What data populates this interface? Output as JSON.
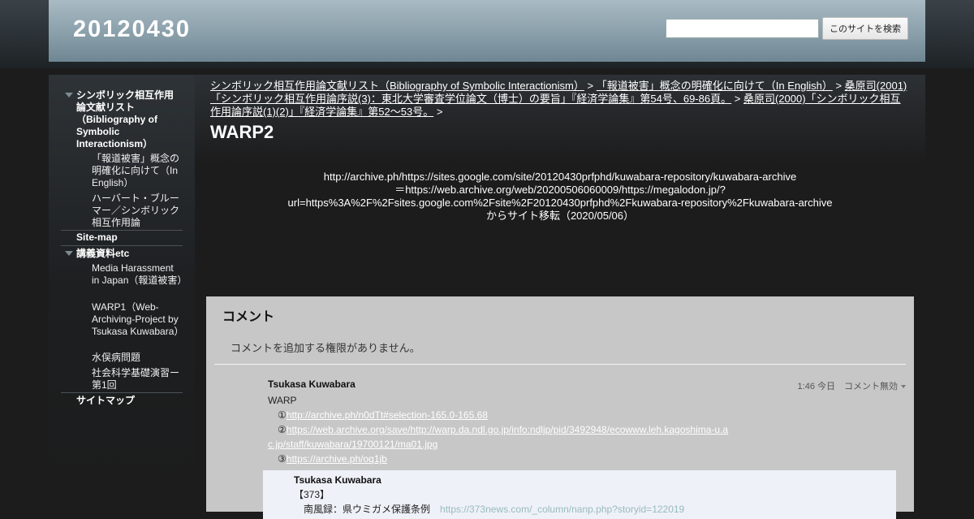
{
  "header": {
    "site_title": "20120430",
    "search_placeholder": "",
    "search_button": "このサイトを検索"
  },
  "sidebar": {
    "items": [
      {
        "label": "シンボリック相互作用論文献リスト（Bibliography of Symbolic Interactionism）"
      },
      {
        "label": "「報道被害」概念の明確化に向けて（In English）"
      },
      {
        "label": "ハーバート・ブルーマー／シンボリック相互作用論"
      },
      {
        "label": "Site-map"
      },
      {
        "label": "講義資料etc"
      },
      {
        "label": "Media Harassment in Japan（報道被害）"
      },
      {
        "label": "WARP1（Web-Archiving-Project by Tsukasa Kuwabara）"
      },
      {
        "label": "水俣病問題"
      },
      {
        "label": "社会科学基礎演習ー第1回"
      },
      {
        "label": "サイトマップ"
      }
    ]
  },
  "breadcrumb": {
    "items": [
      "シンボリック相互作用論文献リスト（Bibliography of Symbolic Interactionism）",
      "「報道被害」概念の明確化に向けて（In English）",
      "桑原司(2001)「シンボリック相互作用論序説(3)：東北大学審査学位論文（博士）の要旨」『経済学論集』第54号、69-86頁。",
      "桑原司(2000)「シンボリック相互作用論序説(1)(2)」『経済学論集』第52～53号。"
    ],
    "separator": ">"
  },
  "page": {
    "title": "WARP2",
    "lines": [
      "http://archive.ph/https://sites.google.com/site/20120430prfphd/kuwabara-repository/kuwabara-archive",
      "＝https://web.archive.org/web/20200506060009/https://megalodon.jp/?",
      "url=https%3A%2F%2Fsites.google.com%2Fsite%2F20120430prfphd%2Fkuwabara-repository%2Fkuwabara-archive",
      "からサイト移転（2020/05/06）"
    ]
  },
  "comments": {
    "title": "コメント",
    "no_permission": "コメントを追加する権限がありません。",
    "list": [
      {
        "author": "Tsukasa Kuwabara",
        "meta": "1:46 今日　コメント無効",
        "text": "WARP",
        "links": [
          {
            "prefix": "　①",
            "text": "http://archive.ph/n0dTt#selection-165.0-165.68"
          },
          {
            "prefix": "　②",
            "text": "https://web.archive.org/save/http://warp.da.ndl.go.jp/info:ndljp/pid/3492948/ecowww.leh.kagoshima-u.ac.jp/staff/kuwabara/19700121/ma01.jpg"
          },
          {
            "prefix": "　③",
            "text": "https://archive.ph/oq1jb"
          }
        ]
      },
      {
        "author": "Tsukasa Kuwabara",
        "text": "【373】",
        "line2": "　南風録：県ウミガメ保護条例",
        "link": "https://373news.com/_column/nanp.php?storyid=122019"
      }
    ]
  }
}
